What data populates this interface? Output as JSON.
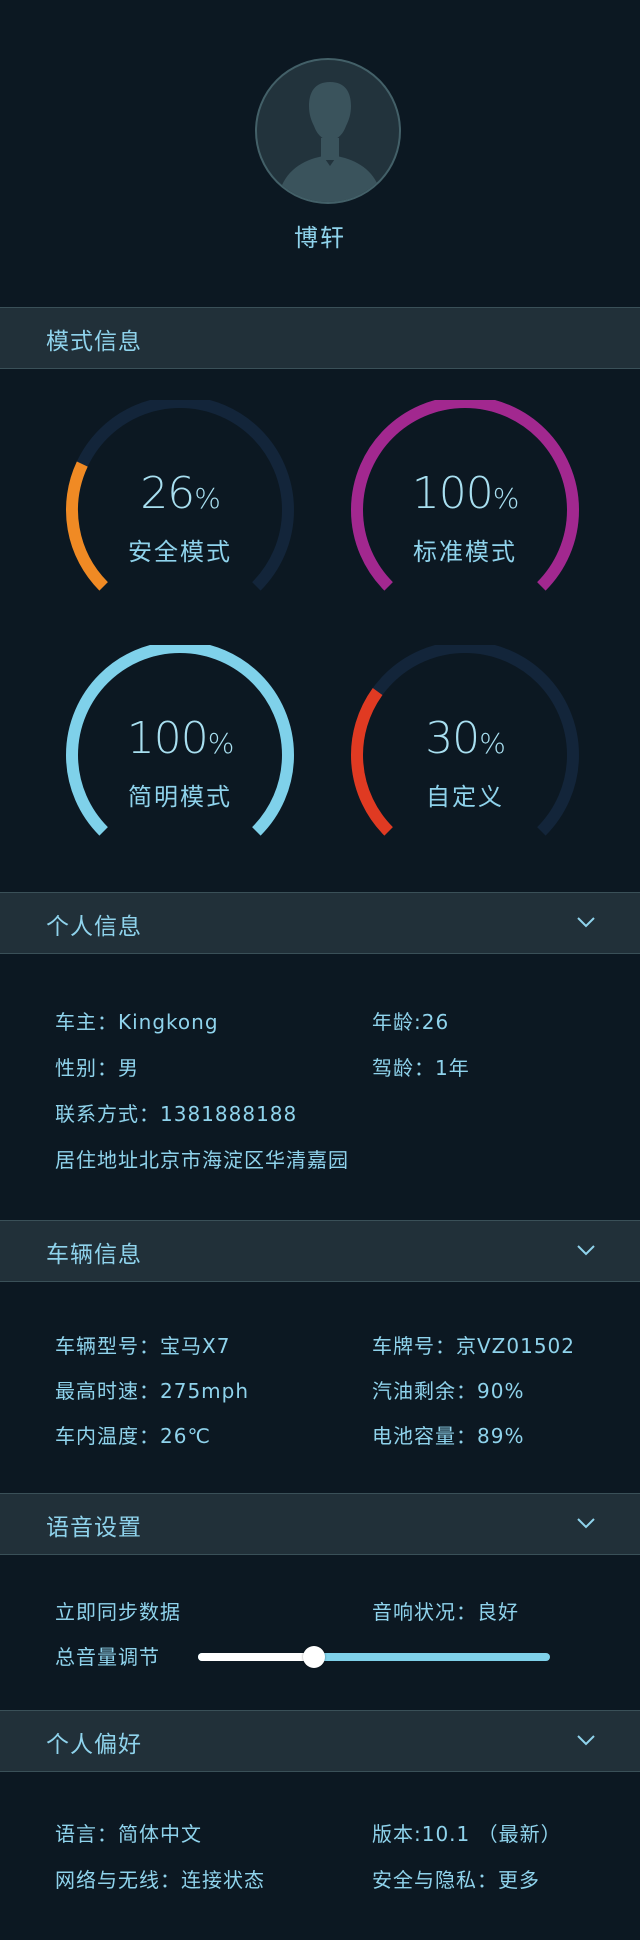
{
  "profile": {
    "name": "博轩"
  },
  "mode_section": {
    "title": "模式信息",
    "gauges": [
      {
        "value": "26",
        "unit": "%",
        "label": "安全模式",
        "fraction": 0.26,
        "color": "#f08a24"
      },
      {
        "value": "100",
        "unit": "%",
        "label": "标准模式",
        "fraction": 1.0,
        "color": "#a2288f"
      },
      {
        "value": "100",
        "unit": "%",
        "label": "简明模式",
        "fraction": 1.0,
        "color": "#7fd1ea"
      },
      {
        "value": "30",
        "unit": "%",
        "label": "自定义",
        "fraction": 0.3,
        "color": "#e03a22"
      }
    ],
    "track_color": "#13253a"
  },
  "personal": {
    "title": "个人信息",
    "owner": "车主：Kingkong",
    "age": "年龄:26",
    "gender": "性别：男",
    "driving_age": "驾龄：1年",
    "contact": "联系方式：1381888188",
    "address": "居住地址北京市海淀区华清嘉园"
  },
  "vehicle": {
    "title": "车辆信息",
    "model": "车辆型号：宝马X7",
    "plate": "车牌号：京VZ01502",
    "max_speed": "最高时速：275mph",
    "fuel": "汽油剩余：90%",
    "temperature": "车内温度：26℃",
    "battery": "电池容量：89%"
  },
  "voice": {
    "title": "语音设置",
    "sync": "立即同步数据",
    "speaker": "音响状况：良好",
    "volume_label": "总音量调节",
    "volume_fraction": 0.33
  },
  "preferences": {
    "title": "个人偏好",
    "language": "语言：简体中文",
    "version": "版本:10.1 （最新）",
    "network": "网络与无线：连接状态",
    "privacy": "安全与隐私：更多"
  }
}
